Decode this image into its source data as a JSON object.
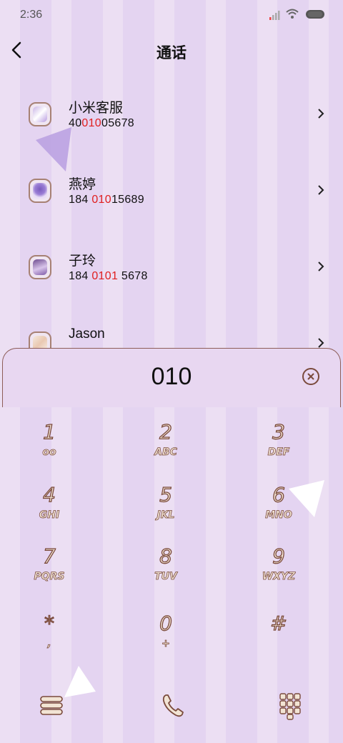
{
  "status": {
    "time": "2:36"
  },
  "header": {
    "title": "通话"
  },
  "contacts": [
    {
      "name": "小米客服",
      "num_pre": "40",
      "num_hl": "010",
      "num_post": "05678"
    },
    {
      "name": "燕婷",
      "num_pre": "184 ",
      "num_hl": "010",
      "num_post": "15689"
    },
    {
      "name": "子玲",
      "num_pre": "184 ",
      "num_hl": "0101",
      "num_post": " 5678"
    },
    {
      "name": "Jason",
      "num_pre": "",
      "num_hl": "",
      "num_post": ""
    }
  ],
  "dialer": {
    "number": "010"
  },
  "keys": [
    {
      "digit": "1",
      "letters": "oo"
    },
    {
      "digit": "2",
      "letters": "ABC"
    },
    {
      "digit": "3",
      "letters": "DEF"
    },
    {
      "digit": "4",
      "letters": "GHI"
    },
    {
      "digit": "5",
      "letters": "JKL"
    },
    {
      "digit": "6",
      "letters": "MNO"
    },
    {
      "digit": "7",
      "letters": "PQRS"
    },
    {
      "digit": "8",
      "letters": "TUV"
    },
    {
      "digit": "9",
      "letters": "WXYZ"
    },
    {
      "digit": "*",
      "letters": ","
    },
    {
      "digit": "0",
      "letters": "+"
    },
    {
      "digit": "#",
      "letters": ""
    }
  ],
  "colors": {
    "highlight": "#e02020",
    "outline": "#7a4a3c",
    "stripe_light": "#ecdff3",
    "stripe_dark": "#e4d4f1"
  },
  "icons": [
    "signal-icon",
    "wifi-icon",
    "battery-icon",
    "back-arrow-icon",
    "chevron-right-icon",
    "clear-icon",
    "menu-icon",
    "phone-icon",
    "keypad-icon"
  ]
}
